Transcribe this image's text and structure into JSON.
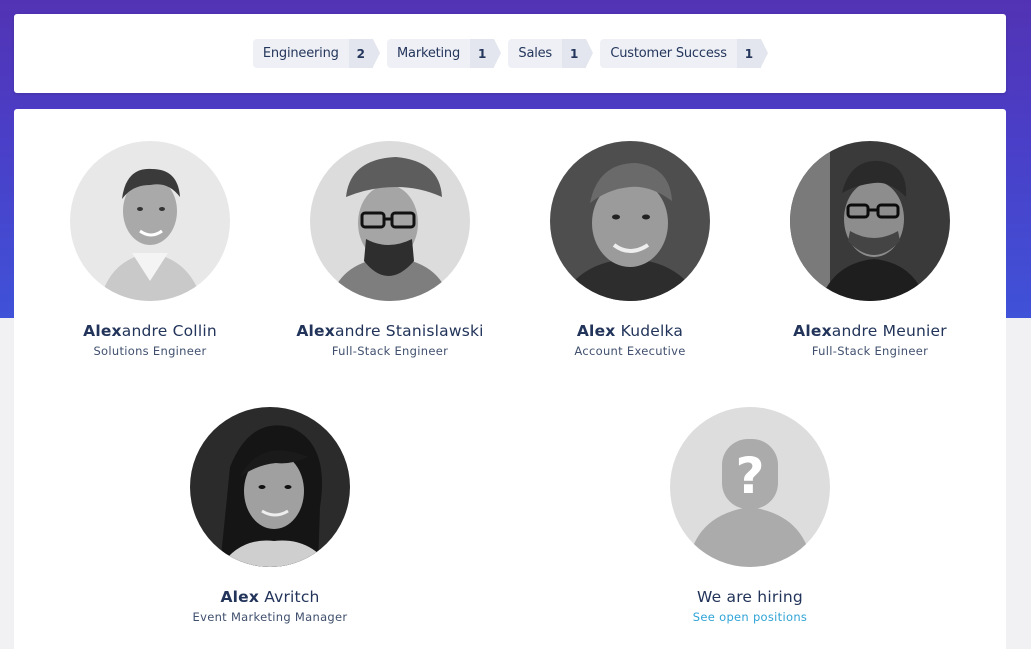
{
  "filters": [
    {
      "label": "Engineering",
      "count": "2"
    },
    {
      "label": "Marketing",
      "count": "1"
    },
    {
      "label": "Sales",
      "count": "1"
    },
    {
      "label": "Customer Success",
      "count": "1"
    }
  ],
  "members": [
    {
      "first": "Alex",
      "rest": "andre Collin",
      "role": "Solutions Engineer"
    },
    {
      "first": "Alex",
      "rest": "andre Stanislawski",
      "role": "Full-Stack Engineer"
    },
    {
      "first": "Alex",
      "rest": " Kudelka",
      "role": "Account Executive"
    },
    {
      "first": "Alex",
      "rest": "andre Meunier",
      "role": "Full-Stack Engineer"
    },
    {
      "first": "Alex",
      "rest": " Avritch",
      "role": "Event Marketing Manager"
    }
  ],
  "hiring": {
    "title": "We are hiring",
    "link": "See open positions"
  },
  "colors": {
    "background_gradient_top": "#5233b4",
    "background_gradient_bottom": "#3f52d8",
    "name_text": "#22345a",
    "link": "#2fa4d6"
  }
}
